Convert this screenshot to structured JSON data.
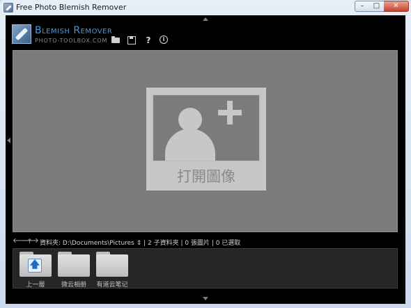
{
  "window": {
    "title": "Free Photo Blemish Remover",
    "controls": {
      "minimize": "–",
      "maximize": "□",
      "close": "✕"
    }
  },
  "brand": {
    "title": "Blemish Remover",
    "subtitle": "PHOTO-TOOLBOX.COM"
  },
  "toolbar": {
    "icons": [
      "open-folder-icon",
      "save-icon",
      "help-icon",
      "info-icon"
    ],
    "help_glyph": "?",
    "info_glyph": "i"
  },
  "canvas": {
    "open_label": "打開圖像"
  },
  "path_bar": {
    "back": "🡐",
    "forward": "🡒",
    "up": "🡑",
    "text": "資料夾: D:\\Documents\\Pictures ⇕ | 2 子資料夾 | 0 張圖片 | 0 已選取"
  },
  "folders": [
    {
      "label": "上一層",
      "type": "up",
      "badge": "🡅"
    },
    {
      "label": "微云相册",
      "type": "folder"
    },
    {
      "label": "有道云笔记",
      "type": "folder"
    }
  ],
  "colors": {
    "background": "#000000",
    "canvas": "#7b7b7b",
    "brand_accent": "#4b97e0"
  }
}
